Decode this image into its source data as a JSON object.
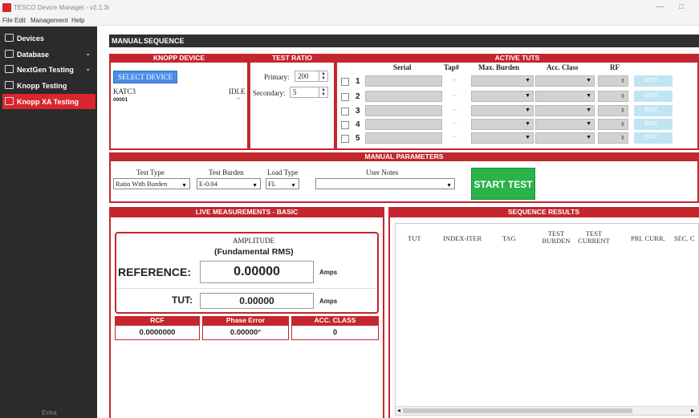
{
  "window": {
    "title": "TESCO Device Manager - v2.1.3r",
    "min": "—",
    "max": "□"
  },
  "menu": [
    "File",
    "Edit",
    "Management",
    "Help"
  ],
  "sidebar": {
    "items": [
      {
        "label": "Devices",
        "chev": ""
      },
      {
        "label": "Database",
        "chev": "⌄"
      },
      {
        "label": "NextGen Testing",
        "chev": "⌄"
      },
      {
        "label": "Knopp Testing",
        "chev": ""
      },
      {
        "label": "Knopp XA Testing",
        "chev": ""
      }
    ],
    "footer": "Extra"
  },
  "tabs": {
    "manual": "MANUAL",
    "sequence": "SEQUENCE"
  },
  "knopp": {
    "header": "KNOPP DEVICE",
    "select_btn": "SELECT DEVICE",
    "device_name": "KATC3",
    "status": "IDLE",
    "serial": "00001",
    "dash": "--"
  },
  "ratio": {
    "header": "TEST RATIO",
    "primary_label": "Primary:",
    "primary_value": "200",
    "secondary_label": "Secondary:",
    "secondary_value": "5"
  },
  "tuts": {
    "header": "ACTIVE TUTS",
    "cols": {
      "serial": "Serial",
      "tap": "Tap#",
      "burden": "Max. Burden",
      "acc": "Acc. Class",
      "rf": "RF"
    },
    "rows": [
      {
        "num": "1",
        "tap": "--",
        "edit": "EDIT..."
      },
      {
        "num": "2",
        "tap": "--",
        "edit": "EDIT..."
      },
      {
        "num": "3",
        "tap": "--",
        "edit": "EDIT..."
      },
      {
        "num": "4",
        "tap": "--",
        "edit": "EDIT..."
      },
      {
        "num": "5",
        "tap": "--",
        "edit": "EDIT..."
      }
    ]
  },
  "params": {
    "header": "MANUAL PARAMETERS",
    "test_type_label": "Test Type",
    "test_type_value": "Ratio With Burden",
    "test_burden_label": "Test Burden",
    "test_burden_value": "E-0.04",
    "load_type_label": "Load Type",
    "load_type_value": "FL",
    "user_notes_label": "User Notes",
    "user_notes_value": "",
    "start_btn": "START TEST"
  },
  "live": {
    "header": "LIVE MEASUREMENTS - BASIC",
    "amplitude": "AMPLITUDE",
    "fund": "(Fundamental RMS)",
    "ref_label": "REFERENCE:",
    "ref_value": "0.00000",
    "tut_label": "TUT:",
    "tut_value": "0.00000",
    "unit": "Amps",
    "rcf_label": "RCF",
    "rcf_value": "0.0000000",
    "phase_label": "Phase Error",
    "phase_value": "0.00000°",
    "acc_label": "ACC. CLASS",
    "acc_value": "0"
  },
  "seq": {
    "header": "SEQUENCE RESULTS",
    "cols": {
      "tut": "TUT",
      "index": "INDEX-ITER",
      "tag": "TAG",
      "burden1": "TEST",
      "burden2": "BURDEN",
      "current1": "TEST",
      "current2": "CURRENT",
      "pri": "PRI. CURR.",
      "sec": "SEC. C"
    },
    "scroll_left": "◂",
    "scroll_right": "▸"
  },
  "icons": {
    "devices": "monitor-icon",
    "database": "database-icon",
    "testing": "clipboard-icon"
  },
  "colors": {
    "accent": "#c4262e",
    "active": "#d8262c",
    "start": "#2bb34a",
    "select": "#4a8fe7",
    "sidebar": "#2b2b2b"
  }
}
